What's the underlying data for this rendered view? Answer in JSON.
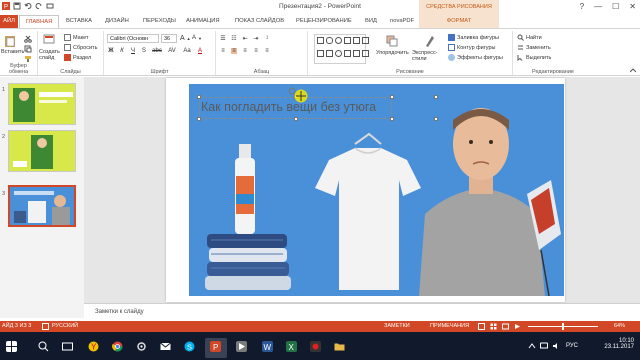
{
  "window": {
    "title": "Презентация2 - PowerPoint",
    "context_header": "СРЕДСТВА РИСОВАНИЯ",
    "controls": [
      "?",
      "—",
      "☐",
      "✕"
    ]
  },
  "tabs": [
    {
      "label": "АЙЛ"
    },
    {
      "label": "ГЛАВНАЯ"
    },
    {
      "label": "ВСТАВКА"
    },
    {
      "label": "ДИЗАЙН"
    },
    {
      "label": "ПЕРЕХОДЫ"
    },
    {
      "label": "АНИМАЦИЯ"
    },
    {
      "label": "ПОКАЗ СЛАЙДОВ"
    },
    {
      "label": "РЕЦЕНЗИРОВАНИЕ"
    },
    {
      "label": "ВИД"
    },
    {
      "label": "novaPDF"
    },
    {
      "label": "ФОРМАТ"
    }
  ],
  "ribbon": {
    "clipboard": {
      "paste": "Вставить",
      "group": "Буфер обмена"
    },
    "slides": {
      "new": "Создать слайд",
      "layout": "Макет",
      "reset": "Сбросить",
      "section": "Раздел",
      "group": "Слайды"
    },
    "font": {
      "name": "Calibri (Основн",
      "size": "36",
      "group": "Шрифт",
      "buttons": [
        "Ж",
        "К",
        "Ч",
        "S",
        "abc",
        "AV",
        "Aa",
        "A"
      ]
    },
    "paragraph": {
      "group": "Абзац",
      "buttons": [
        "≡",
        "≡",
        "≡",
        "≡",
        "≡"
      ]
    },
    "drawing": {
      "arrange": "Упорядочить",
      "quick_styles": "Экспресс-стили",
      "fill": "Заливка фигуры",
      "outline": "Контур фигуры",
      "effects": "Эффекты фигуры",
      "group": "Рисование"
    },
    "editing": {
      "find": "Найти",
      "replace": "Заменить",
      "select": "Выделить",
      "group": "Редактирование"
    }
  },
  "thumbnails": [
    {
      "num": "1",
      "colors": [
        "#d8e84a",
        "#2e7d32"
      ]
    },
    {
      "num": "2",
      "colors": [
        "#d8e84a",
        "#2e7d32"
      ]
    },
    {
      "num": "3",
      "colors": [
        "#4a90d9",
        "#ffffff"
      ],
      "selected": true
    }
  ],
  "slide": {
    "title": "Как погладить вещи без утюга",
    "background": "#4a90d9"
  },
  "notes": {
    "label": "Заметки к слайду"
  },
  "status": {
    "slide_info": "АЙД 3 ИЗ 3",
    "language": "РУССКИЙ",
    "notes_btn": "ЗАМЕТКИ",
    "comments_btn": "ПРИМЕЧАНИЯ",
    "zoom": "64%"
  },
  "taskbar": {
    "time": "10:10",
    "date": "23.11.2017",
    "lang": "РУС",
    "apps": [
      "start-icon",
      "search-icon",
      "task-view-icon",
      "yandex-icon",
      "chrome-icon",
      "settings-icon",
      "email-icon",
      "skype-icon",
      "powerpoint-icon",
      "media-icon",
      "word-icon",
      "excel-icon",
      "record-icon",
      "folder-icon"
    ]
  },
  "colors": {
    "accent": "#d24726",
    "context": "#c55a11",
    "taskbar": "#111a2c",
    "slide_bg": "#4a90d9"
  }
}
